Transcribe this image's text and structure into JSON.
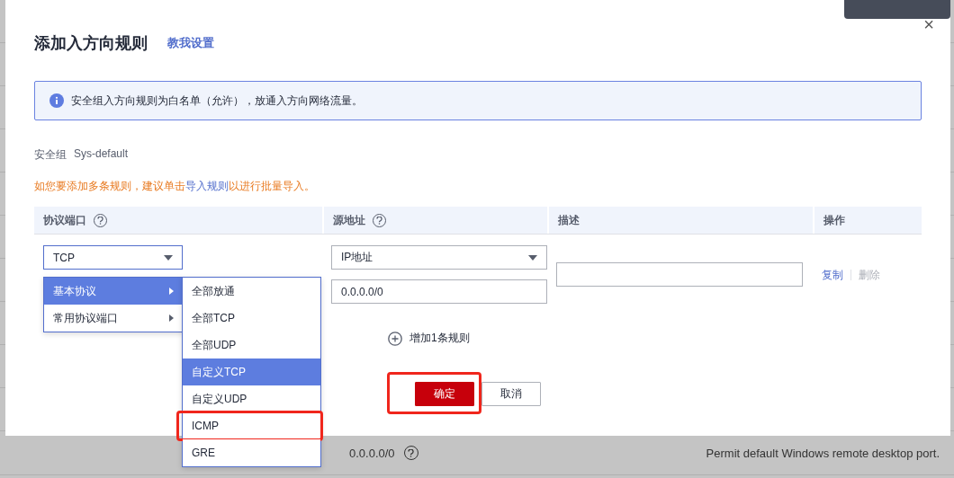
{
  "background": {
    "rows": [
      {
        "source": "0.0.0.0/0",
        "description": "Permit default Windows remote desktop port."
      }
    ]
  },
  "dialog": {
    "title": "添加入方向规则",
    "help_link": "教我设置",
    "close": "×",
    "info": "安全组入方向规则为白名单（允许），放通入方向网络流量。",
    "security_group": {
      "label": "安全组",
      "value": "Sys-default"
    },
    "notice": {
      "before": "如您要添加多条规则，建议单击",
      "link": "导入规则",
      "after": "以进行批量导入。"
    },
    "table": {
      "columns": [
        {
          "label": "协议端口",
          "help": true
        },
        {
          "label": "源地址",
          "help": true
        },
        {
          "label": "描述",
          "help": false
        },
        {
          "label": "操作",
          "help": false
        }
      ],
      "rows": [
        {
          "protocol": "TCP",
          "source_type": "IP地址",
          "source": "0.0.0.0/0",
          "actions": [
            {
              "label": "复制",
              "disabled": false
            },
            {
              "label": "删除",
              "disabled": true
            }
          ]
        }
      ]
    },
    "add_rule": "增加1条规则",
    "buttons": [
      {
        "label": "确定",
        "kind": "primary",
        "highlighted": true
      },
      {
        "label": "取消",
        "kind": "default",
        "highlighted": false
      }
    ],
    "protocol_menu": {
      "items": [
        {
          "label": "基本协议",
          "selected": true
        },
        {
          "label": "常用协议端口",
          "selected": false
        }
      ],
      "submenu": [
        {
          "label": "全部放通",
          "selected": false,
          "highlighted": false
        },
        {
          "label": "全部TCP",
          "selected": false,
          "highlighted": false
        },
        {
          "label": "全部UDP",
          "selected": false,
          "highlighted": false
        },
        {
          "label": "自定义TCP",
          "selected": true,
          "highlighted": false
        },
        {
          "label": "自定义UDP",
          "selected": false,
          "highlighted": false
        },
        {
          "label": "ICMP",
          "selected": false,
          "highlighted": true
        },
        {
          "label": "GRE",
          "selected": false,
          "highlighted": false
        }
      ]
    }
  }
}
